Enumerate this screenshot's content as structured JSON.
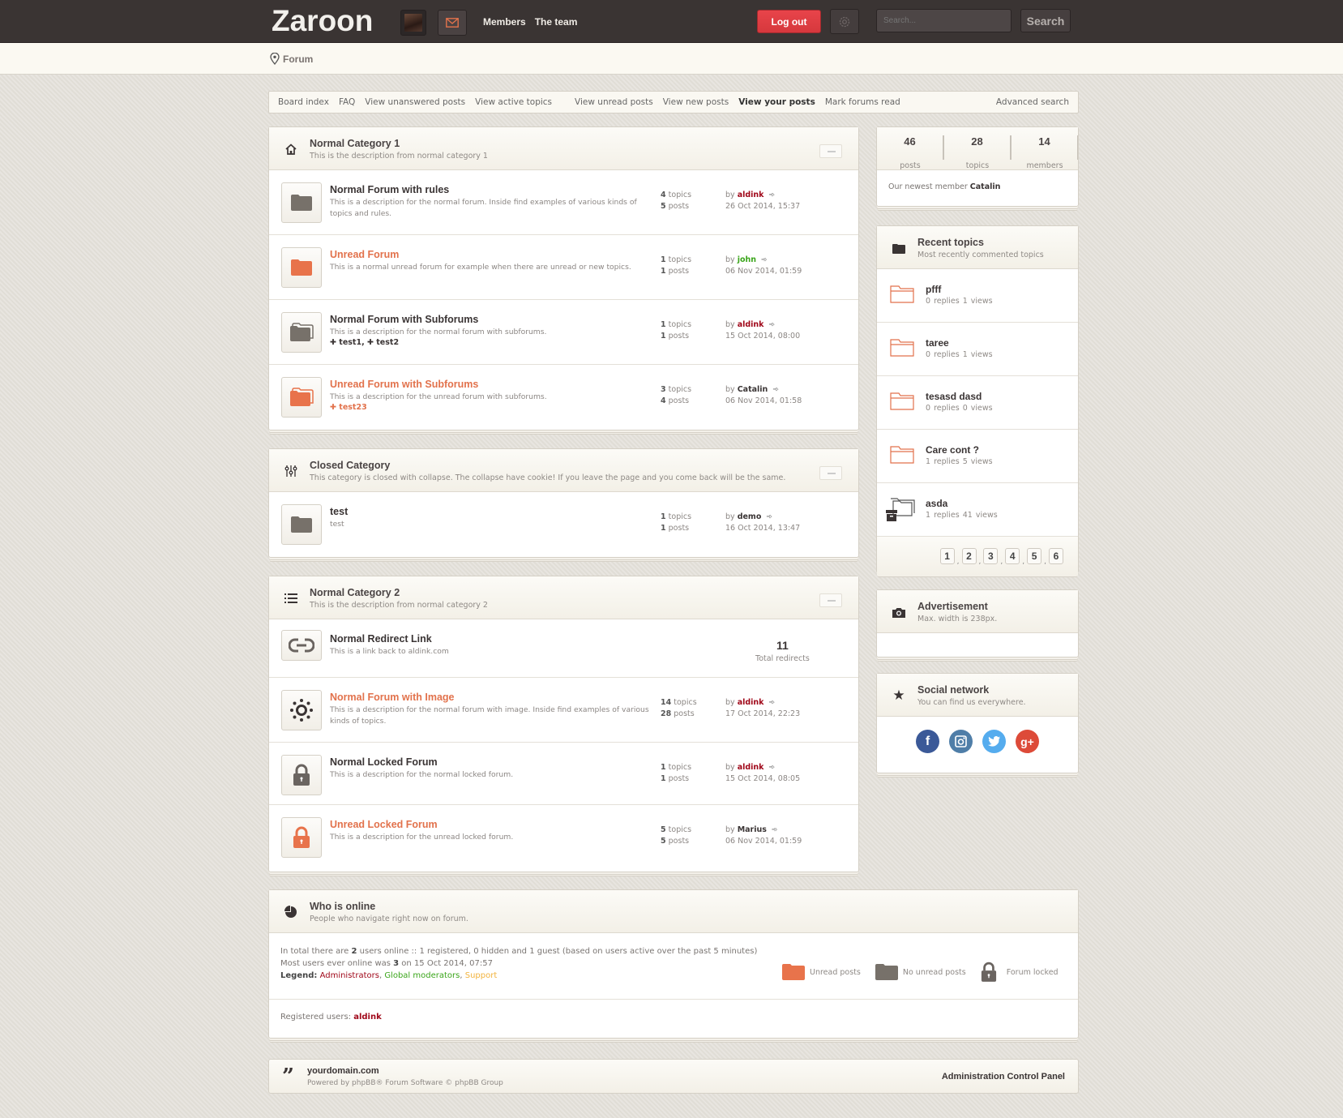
{
  "header": {
    "logo": "Zaroon",
    "nav": [
      "Members",
      "The team"
    ],
    "logout_label": "Log out",
    "search_placeholder": "Search...",
    "search_label": "Search",
    "accent": "#e2724c"
  },
  "breadcrumb": {
    "label": "Forum"
  },
  "navbar": {
    "left": [
      "Board index",
      "FAQ",
      "View unanswered posts",
      "View active topics"
    ],
    "middle": [
      "View unread posts",
      "View new posts"
    ],
    "bold": "View your posts",
    "mark": "Mark forums read",
    "advanced": "Advanced search"
  },
  "categories": [
    {
      "title": "Normal Category 1",
      "description": "This is the description from normal category 1",
      "forums": [
        {
          "title": "Normal Forum with rules",
          "description": "This is a description for the normal forum. Inside find examples of various kinds of topics and rules.",
          "topics": "4",
          "posts": "5",
          "by": "aldink",
          "date": "26 Oct 2014, 15:37"
        },
        {
          "title": "Unread Forum",
          "description": "This is a normal unread forum for example when there are unread or new topics.",
          "topics": "1",
          "posts": "1",
          "by": "john",
          "date": "06 Nov 2014, 01:59"
        },
        {
          "title": "Normal Forum with Subforums",
          "description": "This is a description for the normal forum with subforums.",
          "subforums": [
            "test1",
            "test2"
          ],
          "topics": "1",
          "posts": "1",
          "by": "aldink",
          "date": "15 Oct 2014, 08:00"
        },
        {
          "title": "Unread Forum with Subforums",
          "description": "This is a description for the unread forum with subforums.",
          "subforums": [
            "test23"
          ],
          "topics": "3",
          "posts": "4",
          "by": "Catalin",
          "date": "06 Nov 2014, 01:58"
        }
      ]
    },
    {
      "title": "Closed Category",
      "description": "This category is closed with collapse. The collapse have cookie! If you leave the page and you come back will be the same.",
      "forums": [
        {
          "title": "test",
          "description": "test",
          "topics": "1",
          "posts": "1",
          "by": "demo",
          "date": "16 Oct 2014, 13:47"
        }
      ]
    },
    {
      "title": "Normal Category 2",
      "description": "This is the description from normal category 2",
      "forums": [
        {
          "title": "Normal Redirect Link",
          "description": "This is a link back to aldink.com",
          "redirects": "11",
          "redirects_label": "Total redirects"
        },
        {
          "title": "Normal Forum with Image",
          "description": "This is a description for the normal forum with image. Inside find examples of various kinds of topics.",
          "topics": "14",
          "posts": "28",
          "by": "aldink",
          "date": "17 Oct 2014, 22:23"
        },
        {
          "title": "Normal Locked Forum",
          "description": "This is a description for the normal locked forum.",
          "topics": "1",
          "posts": "1",
          "by": "aldink",
          "date": "15 Oct 2014, 08:05"
        },
        {
          "title": "Unread Locked Forum",
          "description": "This is a description for the unread locked forum.",
          "topics": "5",
          "posts": "5",
          "by": "Marius",
          "date": "06 Nov 2014, 01:59"
        }
      ]
    }
  ],
  "labels": {
    "topics": "topics",
    "posts": "posts",
    "by": "by"
  },
  "stats": {
    "posts": "46",
    "posts_label": "posts",
    "topics": "28",
    "topics_label": "topics",
    "members": "14",
    "members_label": "members",
    "newest_prefix": "Our newest member",
    "newest": "Catalin"
  },
  "recent": {
    "title": "Recent topics",
    "subtitle": "Most recently commented topics",
    "items": [
      {
        "title": "pfff",
        "meta": "0 replies   1 views"
      },
      {
        "title": "taree",
        "meta": "0 replies   1 views"
      },
      {
        "title": "tesasd dasd",
        "meta": "0 replies   0 views"
      },
      {
        "title": "Care cont ?",
        "meta": "1 replies   5 views"
      },
      {
        "title": "asda",
        "meta": "1 replies   41 views"
      }
    ],
    "pages": [
      "1",
      "2",
      "3",
      "4",
      "5",
      "6"
    ]
  },
  "ad": {
    "title": "Advertisement",
    "subtitle": "Max. width is 238px."
  },
  "social": {
    "title": "Social network",
    "subtitle": "You can find us everywhere.",
    "networks": [
      "f",
      "ig",
      "t",
      "g+"
    ]
  },
  "online": {
    "title": "Who is online",
    "subtitle": "People who navigate right now on forum.",
    "line1_a": "In total there are ",
    "line1_b": "2",
    "line1_c": " users online :: 1 registered, 0 hidden and 1 guest (based on users active over the past 5 minutes)",
    "line2_a": "Most users ever online was ",
    "line2_b": "3",
    "line2_c": " on 15 Oct 2014, 07:57",
    "legend_label": "Legend:",
    "legend": [
      "Administrators",
      "Global moderators",
      "Support"
    ],
    "registered_label": "Registered users:",
    "registered": "aldink",
    "icons": [
      "Unread posts",
      "No unread posts",
      "Forum locked"
    ]
  },
  "footer": {
    "site": "yourdomain.com",
    "powered": "Powered by phpBB® Forum Software © phpBB Group",
    "acp": "Administration Control Panel"
  }
}
